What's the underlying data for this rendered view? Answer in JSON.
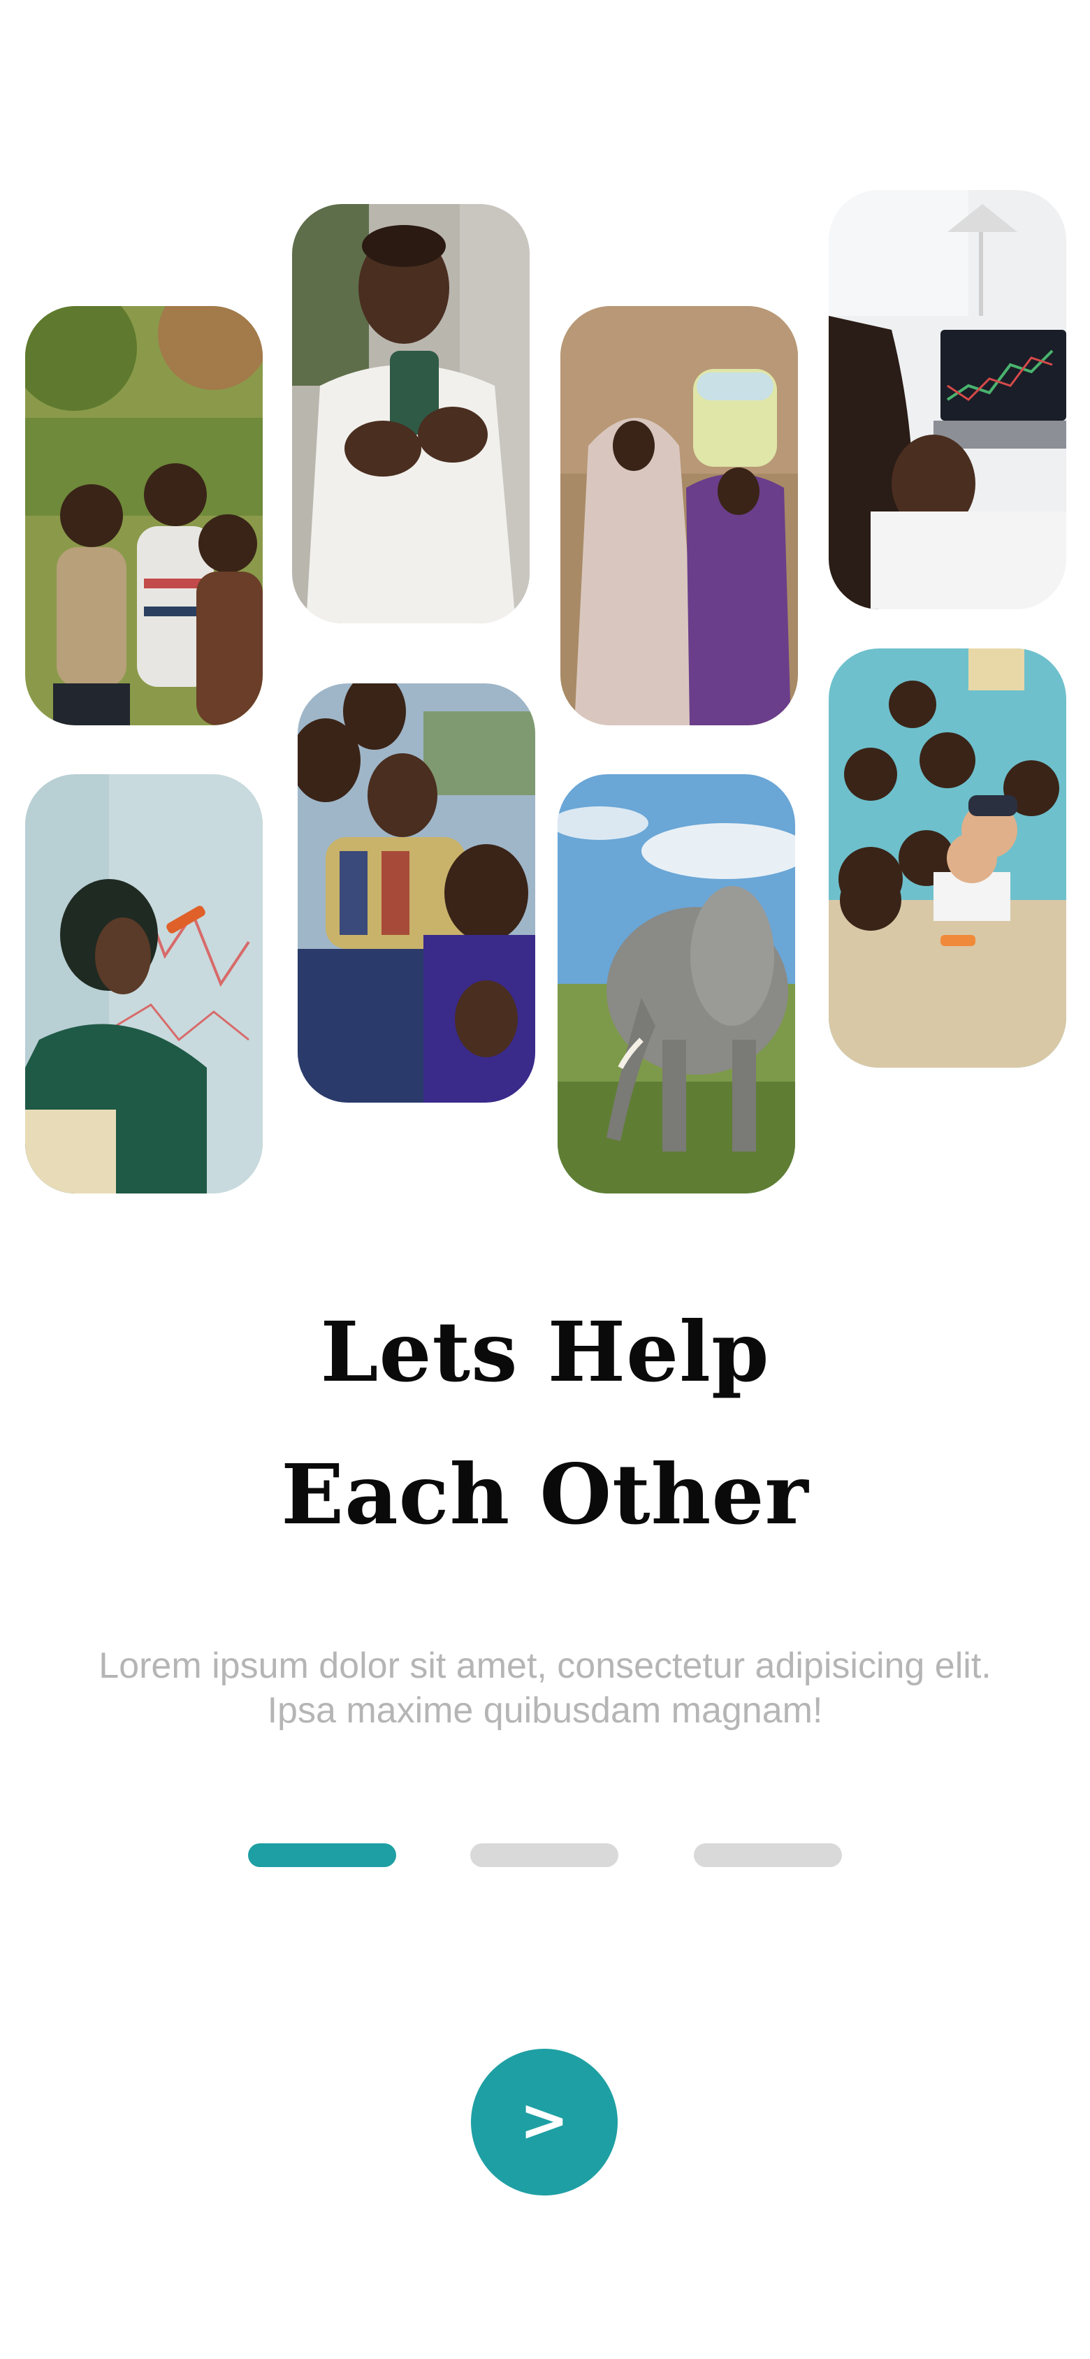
{
  "onboarding": {
    "title_line1": "Lets Help",
    "title_line2": "Each Other",
    "description": "Lorem ipsum dolor sit amet, consectetur adipisicing elit. Ipsa maxime quibusdam magnam!",
    "next_label": ">",
    "current_page": 1,
    "total_pages": 3
  },
  "colors": {
    "accent": "#1e9fa3",
    "indicator_inactive": "#d9d9d9",
    "title": "#0a0a0a",
    "description": "#b5b5b5"
  },
  "gallery": [
    {
      "name": "photo-children-group",
      "icon": "children-photo"
    },
    {
      "name": "photo-woman-phone",
      "icon": "woman-phone-photo"
    },
    {
      "name": "photo-women-water",
      "icon": "women-water-photo"
    },
    {
      "name": "photo-laptop-trading",
      "icon": "laptop-photo"
    },
    {
      "name": "photo-woman-whiteboard",
      "icon": "whiteboard-photo"
    },
    {
      "name": "photo-family-group",
      "icon": "family-photo"
    },
    {
      "name": "photo-elephant",
      "icon": "elephant-photo"
    },
    {
      "name": "photo-classroom-selfie",
      "icon": "classroom-photo"
    }
  ]
}
